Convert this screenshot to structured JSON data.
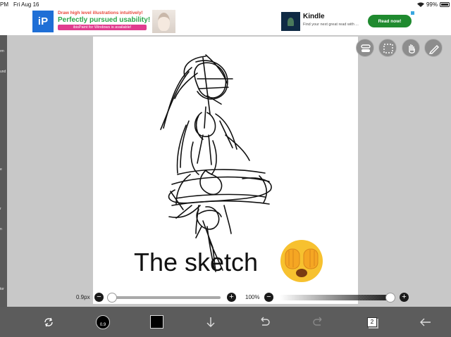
{
  "status_bar": {
    "time": "PM",
    "date": "Fri Aug 16",
    "battery": "99%"
  },
  "ad_left": {
    "logo": "iP",
    "line1": "Draw high level illustrations intuitively!",
    "line2": "Perfectly pursued usability!",
    "line3": "ibisPaint for Windows is available!"
  },
  "ad_right": {
    "title": "Kindle",
    "subtitle": "Find your next great read with ...",
    "button": "Read now!"
  },
  "left_panel": {
    "labels": [
      "rm",
      "und",
      "e",
      "r",
      "n",
      "tor",
      "per"
    ]
  },
  "canvas": {
    "caption": "The sketch",
    "emoji": "face-with-covered-eyes"
  },
  "tools_top": [
    "toggle-icon",
    "selection-icon",
    "hand-icon",
    "pen-icon"
  ],
  "brush": {
    "size_label": "0.9px",
    "size_value": 0.9,
    "size_fraction": 0.02,
    "minus": "−",
    "plus": "+"
  },
  "opacity": {
    "label": "100%",
    "value_fraction": 1.0,
    "minus": "−",
    "plus": "+"
  },
  "toolbar": {
    "brush_size_badge": "0.9",
    "color": "#000000",
    "layer_count": "2",
    "icons": [
      "transform-icon",
      "brush-size-icon",
      "color-icon",
      "down-arrow-icon",
      "undo-icon",
      "redo-icon",
      "layers-icon",
      "back-arrow-icon"
    ]
  }
}
